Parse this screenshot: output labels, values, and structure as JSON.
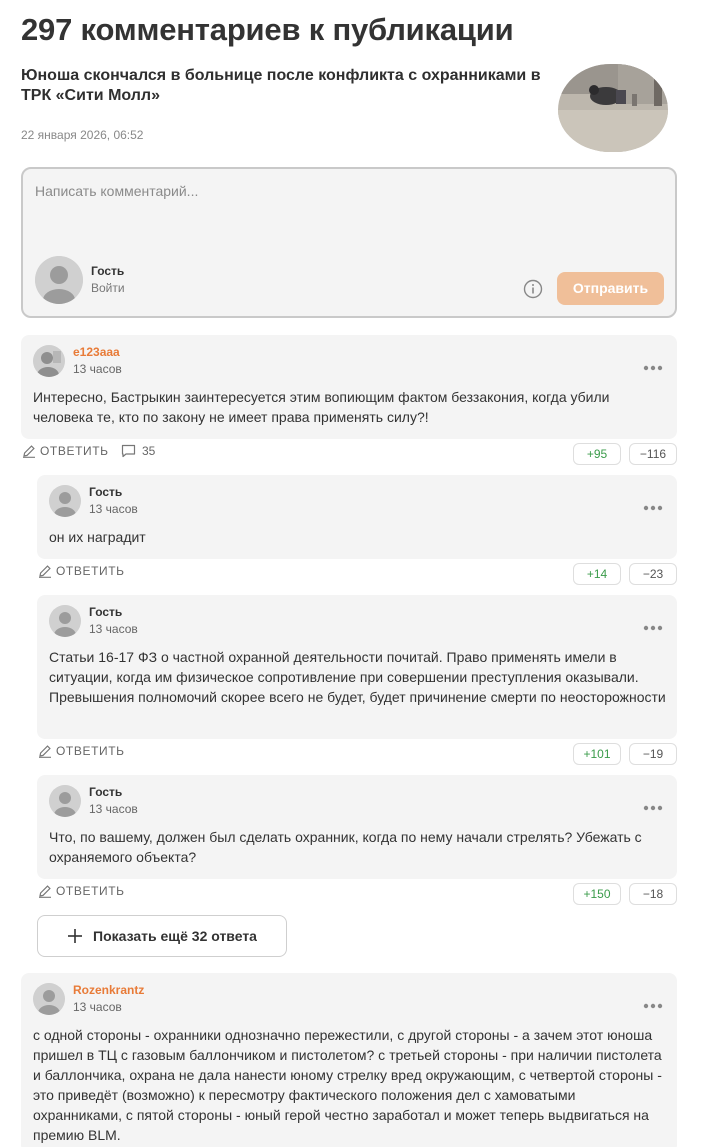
{
  "header": {
    "title": "297 комментариев к публикации"
  },
  "article": {
    "title": "Юноша скончался в больнице после конфликта с охранниками в ТРК «Сити Молл»",
    "date": "22 января 2026, 06:52"
  },
  "compose": {
    "placeholder": "Написать комментарий...",
    "user_name": "Гость",
    "login_label": "Войти",
    "send_label": "Отправить"
  },
  "comments": [
    {
      "author": "e123aaa",
      "time": "13 часов",
      "text": "Интересно, Бастрыкин заинтересуется этим вопиющим фактом беззакония, когда убили человека те, кто по закону не имеет права применять силу?!",
      "reply_label": "ОТВЕТИТЬ",
      "replies_count": "35",
      "likes": "+95",
      "dislikes": "−116"
    },
    {
      "author": "Гость",
      "time": "13 часов",
      "text": "он их наградит",
      "reply_label": "ОТВЕТИТЬ",
      "likes": "+14",
      "dislikes": "−23"
    },
    {
      "author": "Гость",
      "time": "13 часов",
      "text": "Статьи 16-17 ФЗ о частной охранной деятельности почитай. Право применять имели в ситуации, когда им физическое сопротивление при совершении преступления оказывали. Превышения полномочий скорее всего не будет, будет причинение смерти по неосторожности",
      "reply_label": "ОТВЕТИТЬ",
      "likes": "+101",
      "dislikes": "−19"
    },
    {
      "author": "Гость",
      "time": "13 часов",
      "text": "Что, по вашему, должен был сделать охранник, когда по нему начали стрелять? Убежать с охраняемого объекта?",
      "reply_label": "ОТВЕТИТЬ",
      "likes": "+150",
      "dislikes": "−18"
    },
    {
      "author": "Rozenkrantz",
      "time": "13 часов",
      "text": "с одной стороны - охранники однозначно пережестили, с другой стороны - а зачем этот юноша пришел в ТЦ с газовым баллончиком и пистолетом? с третьей стороны - при наличии пистолета и баллончика, охрана не дала нанести юному стрелку вред окружающим, с четвертой стороны - это приведёт (возможно) к пересмотру фактического положения дел с хамоватыми охранниками, с пятой стороны - юный герой честно заработал и может теперь выдвигаться на премию BLM."
    }
  ],
  "show_more": {
    "label": "Показать ещё 32 ответа"
  },
  "colors": {
    "accent": "#e87b38",
    "send_button": "#f0bf99",
    "positive": "#3a9b4a",
    "card_bg": "#f4f4f4"
  },
  "icons": [
    "news-thumbnail",
    "user-avatar-icon",
    "info-icon",
    "more-dots-icon",
    "pencil-icon",
    "comment-bubble-icon",
    "plus-icon"
  ]
}
